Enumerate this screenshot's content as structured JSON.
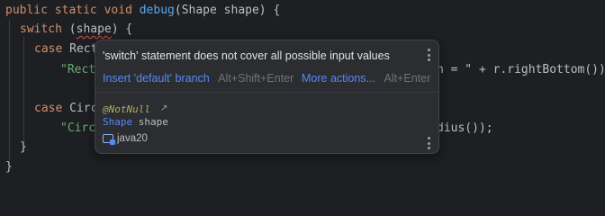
{
  "code": {
    "line1": {
      "kw1": "public",
      "kw2": "static",
      "kw3": "void",
      "fn": "debug",
      "rest": "(Shape shape) {"
    },
    "line2": {
      "kw": "switch",
      "open": " (",
      "arg": "shape",
      "close": ") {"
    },
    "line3": {
      "kw": "case",
      "text": " Rect"
    },
    "line4": {
      "str": "\"Rect",
      "tail": "n = \" + r.rightBottom());"
    },
    "line6": {
      "kw": "case",
      "text": " Circ"
    },
    "line7": {
      "str": "\"Circ",
      "tail": "dius());"
    },
    "line8": {
      "text": "}"
    },
    "line9": {
      "text": "}"
    }
  },
  "popup": {
    "message": "'switch' statement does not cover all possible input values",
    "fix_label": "Insert 'default' branch",
    "fix_shortcut": "Alt+Shift+Enter",
    "more_label": "More actions...",
    "more_shortcut": "Alt+Enter",
    "annotation": "@NotNull",
    "arrow": "↗",
    "param_type": "Shape",
    "param_name": "shape",
    "module": "java20"
  }
}
